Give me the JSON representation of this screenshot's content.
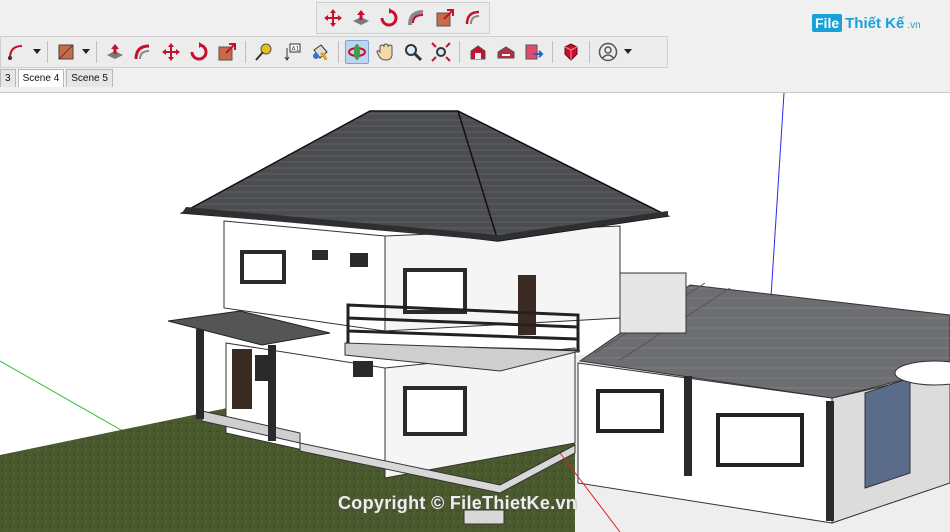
{
  "app": {
    "name": "SketchUp"
  },
  "toolbar_top": {
    "tools": [
      {
        "name": "move-icon"
      },
      {
        "name": "push-pull-icon"
      },
      {
        "name": "rotate-icon"
      },
      {
        "name": "follow-me-icon"
      },
      {
        "name": "scale-icon"
      },
      {
        "name": "offset-icon"
      }
    ]
  },
  "toolbar_main": {
    "tools": [
      {
        "name": "arc-icon",
        "dropdown": true
      },
      {
        "name": "rectangle-icon",
        "dropdown": true
      },
      {
        "name": "push-pull-icon"
      },
      {
        "name": "follow-me-icon"
      },
      {
        "name": "move-icon"
      },
      {
        "name": "rotate-icon"
      },
      {
        "name": "scale-icon"
      },
      {
        "name": "tape-measure-icon"
      },
      {
        "name": "text-icon"
      },
      {
        "name": "paint-bucket-icon"
      },
      {
        "name": "orbit-icon",
        "active": true
      },
      {
        "name": "pan-icon"
      },
      {
        "name": "zoom-icon"
      },
      {
        "name": "zoom-extents-icon"
      },
      {
        "name": "warehouse-icon"
      },
      {
        "name": "extension-warehouse-icon"
      },
      {
        "name": "layout-send-icon"
      },
      {
        "name": "extension-manager-icon"
      },
      {
        "name": "account-icon",
        "dropdown": true
      }
    ]
  },
  "logo": {
    "badge": "File",
    "text": "Thiết Kế",
    "suffix": ".vn"
  },
  "scene_tabs": [
    {
      "label": "3",
      "active": false
    },
    {
      "label": "Scene 4",
      "active": true
    },
    {
      "label": "Scene 5",
      "active": false
    }
  ],
  "watermark": "Copyright © FileThietKe.vn",
  "colors": {
    "toolbar_bg": "#ececec",
    "active_tool": "#bcd6f2",
    "grass": "#4a5a2e",
    "roof": "#4b4d50",
    "wall": "#ffffff",
    "axis_blue": "#2a2af0",
    "axis_green": "#2fbf2f",
    "axis_red": "#e02020",
    "logo_blue": "#1aa0d8"
  }
}
